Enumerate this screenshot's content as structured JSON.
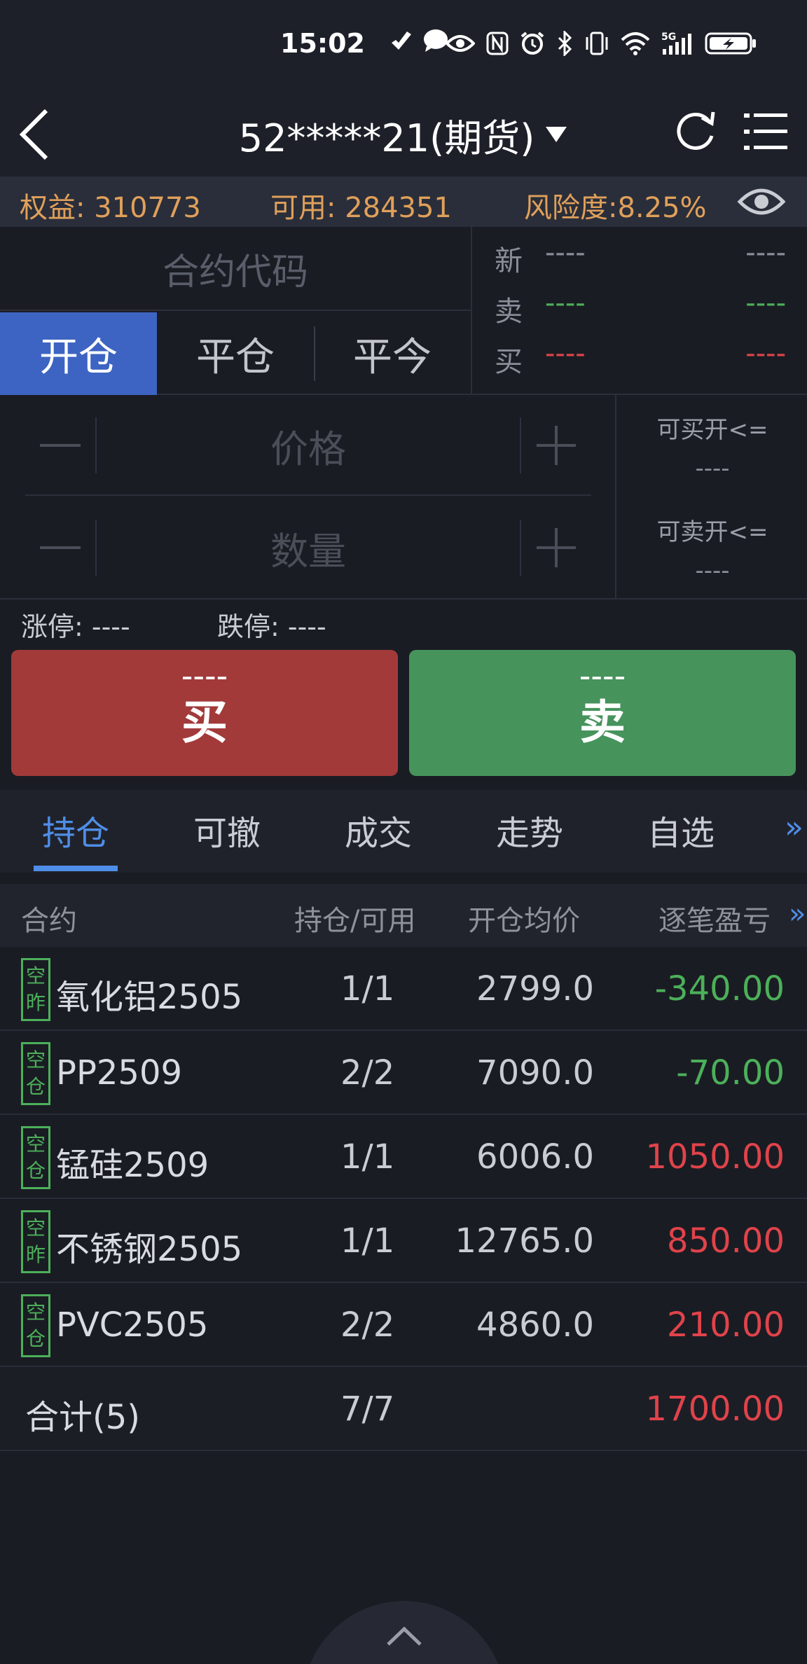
{
  "status": {
    "time": "15:02",
    "icons": [
      "vpn-key-icon",
      "chat-bubble-icon",
      "eye-icon",
      "nfc-icon",
      "alarm-icon",
      "bluetooth-icon",
      "vibrate-icon",
      "wifi-icon",
      "signal-5g-icon",
      "battery-charging-icon"
    ],
    "network_label": "5G"
  },
  "nav": {
    "title": "52*****21(期货)"
  },
  "account": {
    "equity": "权益: 310773",
    "available": "可用: 284351",
    "risk": "风险度:8.25%"
  },
  "order": {
    "contract_placeholder": "合约代码",
    "modes": [
      "开仓",
      "平仓",
      "平今"
    ],
    "active_mode": "开仓",
    "quote": {
      "last_label": "新",
      "last_value": "----",
      "last_value2": "----",
      "ask_label": "卖",
      "ask_value": "----",
      "ask_value2": "----",
      "bid_label": "买",
      "bid_value": "----",
      "bid_value2": "----"
    },
    "price_placeholder": "价格",
    "qty_placeholder": "数量",
    "can_buy_label": "可买开<=",
    "can_buy_value": "----",
    "can_sell_label": "可卖开<=",
    "can_sell_value": "----",
    "limit_up": "涨停: ----",
    "limit_down": "跌停: ----",
    "buy_price": "----",
    "buy_label": "买",
    "sell_price": "----",
    "sell_label": "卖"
  },
  "tabs": [
    "持仓",
    "可撤",
    "成交",
    "走势",
    "自选"
  ],
  "tabs_more": "»",
  "table": {
    "headers": {
      "contract": "合约",
      "hold": "持仓/可用",
      "avg_price": "开仓均价",
      "pnl": "逐笔盈亏",
      "more": "»"
    },
    "rows": [
      {
        "tag1": "空",
        "tag2": "昨",
        "name": "氧化铝2505",
        "hold": "1/1",
        "price": "2799.0",
        "pnl": "-340.00",
        "sign": "neg"
      },
      {
        "tag1": "空",
        "tag2": "仓",
        "name": "PP2509",
        "hold": "2/2",
        "price": "7090.0",
        "pnl": "-70.00",
        "sign": "neg"
      },
      {
        "tag1": "空",
        "tag2": "仓",
        "name": "锰硅2509",
        "hold": "1/1",
        "price": "6006.0",
        "pnl": "1050.00",
        "sign": "pos"
      },
      {
        "tag1": "空",
        "tag2": "昨",
        "name": "不锈钢2505",
        "hold": "1/1",
        "price": "12765.0",
        "pnl": "850.00",
        "sign": "pos"
      },
      {
        "tag1": "空",
        "tag2": "仓",
        "name": "PVC2505",
        "hold": "2/2",
        "price": "4860.0",
        "pnl": "210.00",
        "sign": "pos"
      }
    ],
    "total": {
      "label": "合计(5)",
      "hold": "7/7",
      "pnl": "1700.00"
    }
  },
  "colors": {
    "accent": "#4f8ee8",
    "buy": "#a23a3a",
    "sell": "#47935c",
    "profit": "#e0434a",
    "loss": "#4cb05a",
    "account_text": "#e0a05a"
  }
}
